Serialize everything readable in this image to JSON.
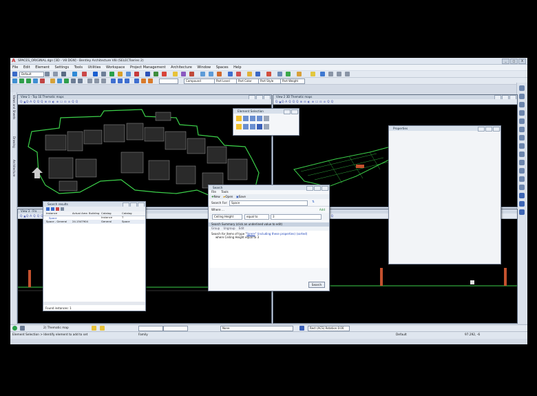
{
  "window": {
    "title": "SPACES_ORIGINAL.dgn [3D - V8 DGN] - Bentley Architecture V8i (SELECTseries 2)",
    "buttons": [
      "_",
      "□",
      "X"
    ]
  },
  "menu": [
    "File",
    "Edit",
    "Element",
    "Settings",
    "Tools",
    "Utilities",
    "Workspace",
    "Project Management",
    "Architecture",
    "Window",
    "Spaces",
    "Help"
  ],
  "toolbar": {
    "level_combo": "Default",
    "compound_combo": "Compound",
    "level_by": "Part Level",
    "color_by": "Part Color",
    "style_by": "Part Style",
    "weight_by": "Part Weight"
  },
  "left_dock_tabs": [
    "Views and Sheets",
    "Drawing",
    "Architecture"
  ],
  "views": {
    "v1": "View 1 - Top 1E Thematic maps",
    "v2": "View 2 3D Thematic maps",
    "v3": "View 3 - Fro",
    "v4": "",
    "tools": "Q·▲Q·A Q Q Q ⊞ ⊟ ◐ ⊕ ☐ ⊡ ⊘ Q Q"
  },
  "element_selection": {
    "title": "Element Selection"
  },
  "properties": {
    "title": "Properties"
  },
  "search_results": {
    "title": "Search results",
    "columns": [
      "Instance",
      "Actual Area",
      "Building",
      "Catalog Instance",
      "Catalog T"
    ],
    "group": "Space",
    "row": {
      "instance": "Space - General",
      "area": "24.1547904",
      "catalog_instance": "General",
      "catalog_type": "Space"
    },
    "footer": "Found instances: 1"
  },
  "search": {
    "title": "Search",
    "menu": [
      "File",
      "Tools"
    ],
    "actions": [
      "New",
      "Open",
      "Save"
    ],
    "search_for_label": "Search For:",
    "search_for_value": "Space",
    "where_label": "Where ...",
    "add_label": "Add",
    "criteria_field": "Ceiling Height",
    "criteria_op": "equal to",
    "criteria_value": "3",
    "summary_header": "Search Summary (click an underlined value to edit)",
    "summary_tools": [
      "Group",
      "Ungroup",
      "Edit"
    ],
    "summary_line1_pre": "Search for items of type \"",
    "summary_type": "Space",
    "summary_line1_post": "\" (including these properties) (sorted)",
    "summary_line2": "where Ceiling Height equal to 3",
    "search_button": "Search"
  },
  "status": {
    "prompt": "Element Selection > Identify element to add to set",
    "family": "Family",
    "none": "None",
    "default": "Default",
    "coords": "97.292, -6",
    "thematic": "2) Thematic map",
    "rotation": "Rect (ACS) Rotation 0.00"
  },
  "colors": {
    "accent": "#1d43b8",
    "plan_outline": "#3cd14a",
    "background": "#000000"
  }
}
